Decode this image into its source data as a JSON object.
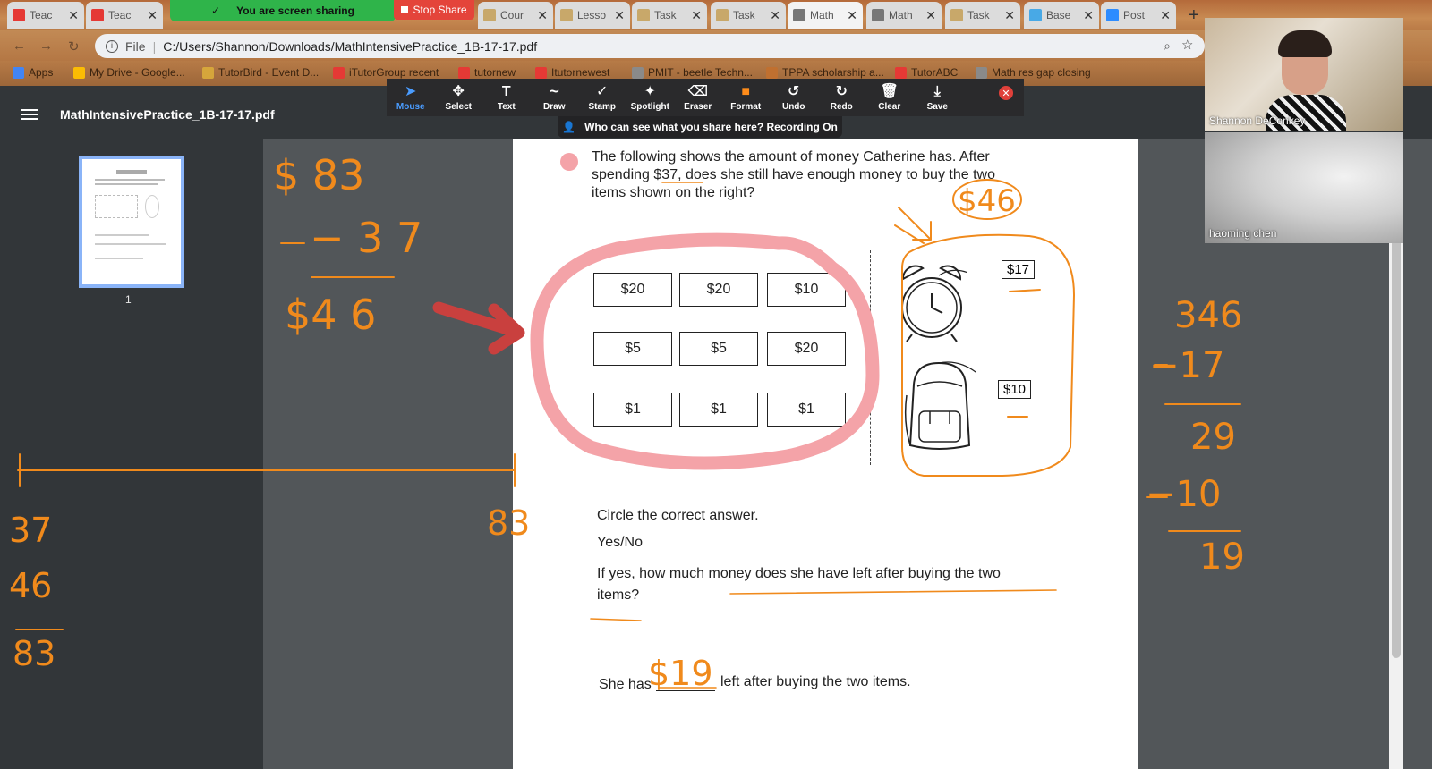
{
  "tabs": [
    {
      "label": "Teac",
      "fav": "#e53935"
    },
    {
      "label": "Teac",
      "fav": "#e53935"
    },
    {
      "label": "Cour",
      "fav": "#c8a86a"
    },
    {
      "label": "Lesso",
      "fav": "#c8a86a"
    },
    {
      "label": "Task",
      "fav": "#c8a86a"
    },
    {
      "label": "Task",
      "fav": "#c8a86a"
    },
    {
      "label": "Math",
      "fav": "#777777"
    },
    {
      "label": "Math",
      "fav": "#777777"
    },
    {
      "label": "Task",
      "fav": "#c8a86a"
    },
    {
      "label": "Base",
      "fav": "#48a9e6"
    },
    {
      "label": "Post",
      "fav": "#2d8cff"
    }
  ],
  "zoom": {
    "sharing_banner": "You are screen sharing",
    "stop_share": "Stop Share",
    "who_can_see": "Who can see what you share here? Recording On"
  },
  "address": {
    "scheme": "File",
    "url": "C:/Users/Shannon/Downloads/MathIntensivePractice_1B-17-17.pdf"
  },
  "bookmarks": [
    "Apps",
    "My Drive - Google...",
    "TutorBird - Event D...",
    "iTutorGroup recent",
    "tutornew",
    "Itutornewest",
    "PMIT - beetle Techn...",
    "TPPA scholarship a...",
    "TutorABC",
    "Math res gap closing"
  ],
  "pdf": {
    "title": "MathIntensivePractice_1B-17-17.pdf",
    "page_number": "1"
  },
  "annotate_tools": [
    "Mouse",
    "Select",
    "Text",
    "Draw",
    "Stamp",
    "Spotlight",
    "Eraser",
    "Format",
    "Undo",
    "Redo",
    "Clear",
    "Save"
  ],
  "question": {
    "line1": "The following shows the amount of money Catherine has. After",
    "line2": "spending $37, does she still have enough money to buy the two",
    "line3": "items shown on the right?",
    "bills": [
      "$20",
      "$20",
      "$10",
      "$5",
      "$5",
      "$20",
      "$1",
      "$1",
      "$1"
    ],
    "price_clock": "$17",
    "price_bag": "$10",
    "circle_prompt": "Circle the correct answer.",
    "yes_no": "Yes/No",
    "if_yes_1": "If yes, how much money does she have left after buying the two",
    "if_yes_2": "items?",
    "she_has": "She has",
    "left_after": "left after buying the two items."
  },
  "handwriting": {
    "top_left": [
      "$ 83",
      "− 3 7",
      "$4 6"
    ],
    "numberline_right": "83",
    "bottom_left": [
      "37",
      "46",
      "83"
    ],
    "right_column": [
      "346",
      "−17",
      "29",
      "−10",
      "19"
    ],
    "price_note": "$46",
    "answer": "$19"
  },
  "videos": [
    {
      "name": "Shannon DeConkey"
    },
    {
      "name": "haoming   chen"
    }
  ],
  "colors": {
    "ink_orange": "#f08a1c",
    "ink_pink": "#f4a3a8",
    "arrow_red": "#c9403e",
    "accent_blue": "#8ab4f8"
  }
}
